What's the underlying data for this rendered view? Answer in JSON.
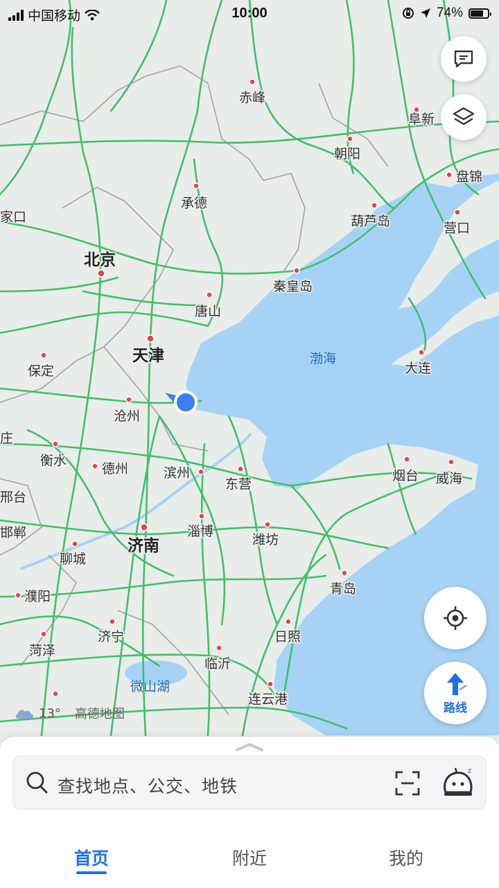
{
  "status_bar": {
    "carrier": "中国移动",
    "time": "10:00",
    "battery": "74%",
    "battery_level": 0.74
  },
  "map": {
    "sea_label": "渤海",
    "lake_label": "微山湖",
    "cities_major": [
      "北京",
      "天津",
      "济南"
    ],
    "cities": [
      "赤峰",
      "阜新",
      "朝阳",
      "盘锦",
      "家口",
      "承德",
      "葫芦岛",
      "营口",
      "秦皇岛",
      "唐山",
      "大连",
      "保定",
      "沧州",
      "庄",
      "衡水",
      "德州",
      "滨州",
      "东营",
      "烟台",
      "威海",
      "邢台",
      "淄博",
      "潍坊",
      "邯郸",
      "聊城",
      "青岛",
      "濮阳",
      "济宁",
      "日照",
      "菏泽",
      "临沂",
      "连云港"
    ],
    "colors": {
      "land": "#e9ede9",
      "water": "#a6d3f5",
      "road": "#3fbf6a",
      "province_border": "#a3a3a3",
      "city_dot": "#e8424a",
      "location": "#3a7ef0"
    }
  },
  "buttons": {
    "message_icon": "chat-bubble-icon",
    "layers_icon": "layers-icon",
    "locate_icon": "crosshair-icon",
    "route_label": "路线"
  },
  "weather": {
    "temperature": "13°",
    "brand": "高德地图"
  },
  "search": {
    "placeholder": "查找地点、公交、地铁"
  },
  "tabs": [
    {
      "label": "首页",
      "active": true
    },
    {
      "label": "附近",
      "active": false
    },
    {
      "label": "我的",
      "active": false
    }
  ]
}
